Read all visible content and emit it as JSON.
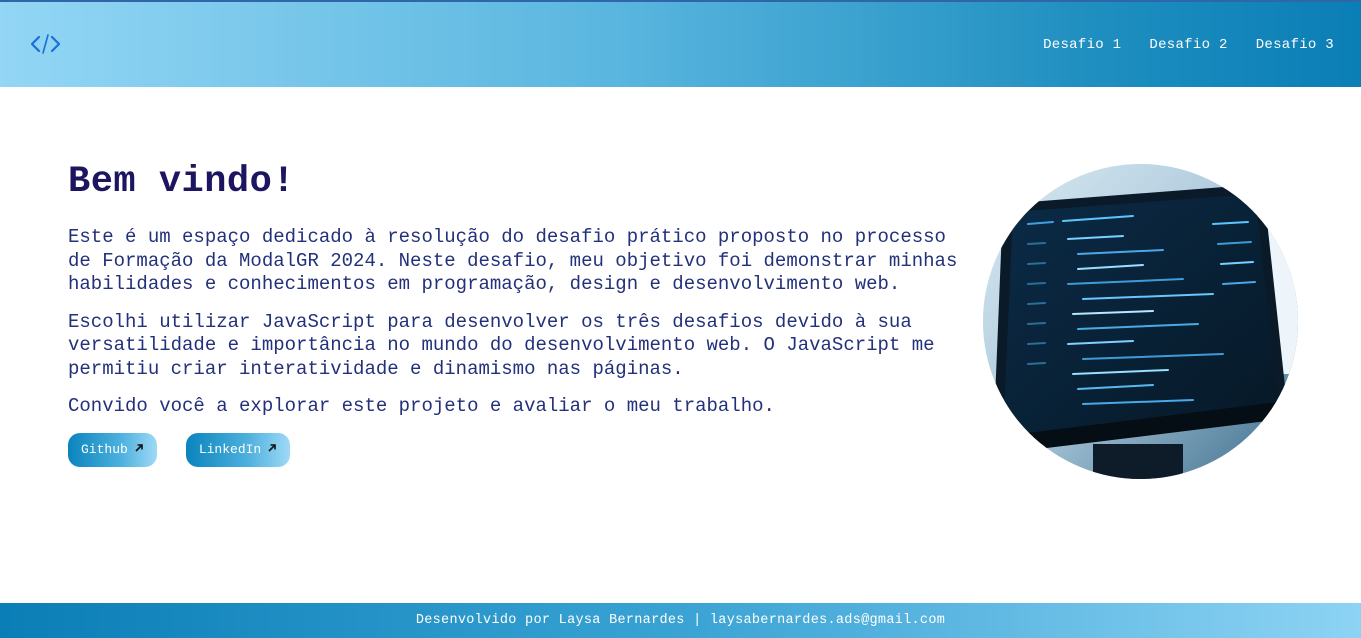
{
  "header": {
    "logo_icon": "code-brackets-icon",
    "nav": [
      {
        "label": "Desafio 1"
      },
      {
        "label": "Desafio 2"
      },
      {
        "label": "Desafio 3"
      }
    ]
  },
  "main": {
    "title": "Bem vindo!",
    "paragraphs": [
      "Este é um espaço dedicado à resolução do desafio prático proposto no processo de Formação da ModalGR 2024. Neste desafio, meu objetivo foi demonstrar minhas habilidades e conhecimentos em programação, design e desenvolvimento web.",
      "Escolhi utilizar JavaScript para desenvolver os três desafios devido à sua versatilidade e importância no mundo do desenvolvimento web. O JavaScript me permitiu criar interatividade e dinamismo nas páginas.",
      "Convido você a explorar este projeto e avaliar o meu trabalho."
    ],
    "buttons": [
      {
        "label": "Github",
        "icon": "arrow-up-right-icon"
      },
      {
        "label": "LinkedIn",
        "icon": "arrow-up-right-icon"
      }
    ]
  },
  "footer": {
    "text": "Desenvolvido por Laysa Bernardes | laysabernardes.ads@gmail.com"
  },
  "colors": {
    "title": "#1c1560",
    "text": "#23307a",
    "accent": "#0a7eb6"
  }
}
